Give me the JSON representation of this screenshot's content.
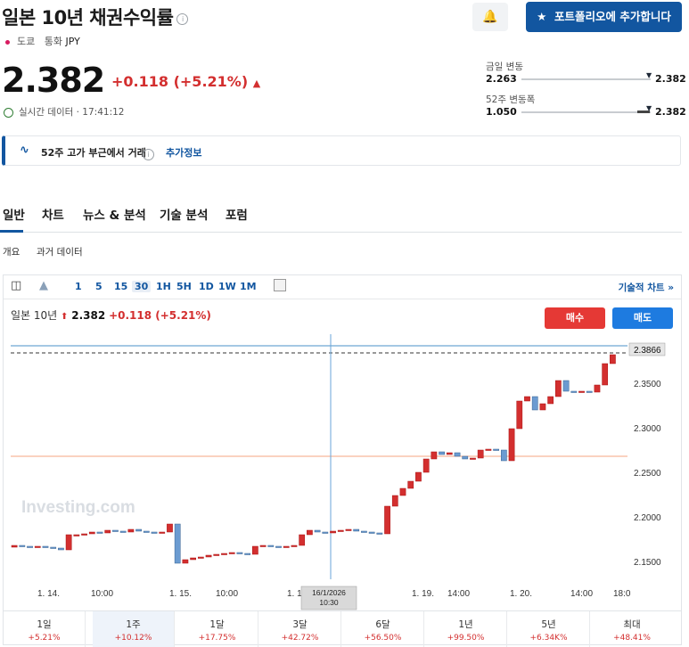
{
  "header": {
    "title": "일본 10년 채권수익률",
    "exchange": "도쿄",
    "currency_label": "통화",
    "currency": "JPY",
    "add_portfolio_label": "포트폴리오에 추가합니다"
  },
  "quote": {
    "price": "2.382",
    "change": "+0.118 (+5.21%)",
    "realtime_label": "실시간 데이터 · 17:41:12"
  },
  "ranges": {
    "day_label": "금일 변동",
    "day_low": "2.263",
    "day_high": "2.382",
    "week52_label": "52주 변동폭",
    "week52_low": "1.050",
    "week52_high": "2.382"
  },
  "banner": {
    "text": "52주 고가 부근에서 거래",
    "more": "추가정보"
  },
  "tabs": [
    "일반",
    "차트",
    "뉴스 & 분석",
    "기술 분석",
    "포럼"
  ],
  "subtabs": [
    "개요",
    "과거 데이터"
  ],
  "toolbar": {
    "timeframes": [
      "1",
      "5",
      "15",
      "30",
      "1H",
      "5H",
      "1D",
      "1W",
      "1M"
    ],
    "selected_timeframe": "30",
    "tech_chart_label": "기술적 차트 »"
  },
  "legend": {
    "name": "일본 10년",
    "price": "2.382",
    "change": "+0.118 (+5.21%)"
  },
  "actions": {
    "buy": "매수",
    "sell": "매도"
  },
  "chart_data": {
    "type": "candlestick",
    "watermark": "Investing.com",
    "y_ticks": [
      "2.3500",
      "2.3000",
      "2.2500",
      "2.2000",
      "2.1500"
    ],
    "price_marker": "2.3866",
    "x_labels": [
      "1. 14.",
      "10:00",
      "1. 15.",
      "10:00",
      "1. 1",
      "1. 19.",
      "14:00",
      "1. 20.",
      "14:00",
      "18:0"
    ],
    "crosshair_label": [
      "16/1/2026",
      "10:30"
    ],
    "y_range": [
      2.13,
      2.4
    ],
    "close_series": [
      2.168,
      2.167,
      2.166,
      2.167,
      2.166,
      2.165,
      2.163,
      2.18,
      2.18,
      2.181,
      2.183,
      2.182,
      2.185,
      2.184,
      2.183,
      2.186,
      2.184,
      2.183,
      2.182,
      2.183,
      2.192,
      2.148,
      2.152,
      2.154,
      2.155,
      2.157,
      2.158,
      2.159,
      2.16,
      2.159,
      2.158,
      2.167,
      2.168,
      2.167,
      2.166,
      2.167,
      2.168,
      2.18,
      2.185,
      2.183,
      2.182,
      2.184,
      2.185,
      2.186,
      2.184,
      2.183,
      2.182,
      2.181,
      2.212,
      2.224,
      2.232,
      2.24,
      2.25,
      2.265,
      2.273,
      2.27,
      2.272,
      2.268,
      2.265,
      2.266,
      2.275,
      2.276,
      2.275,
      2.263,
      2.299,
      2.33,
      2.335,
      2.32,
      2.327,
      2.335,
      2.353,
      2.341,
      2.34,
      2.341,
      2.34,
      2.348,
      2.372,
      2.382
    ]
  }
}
